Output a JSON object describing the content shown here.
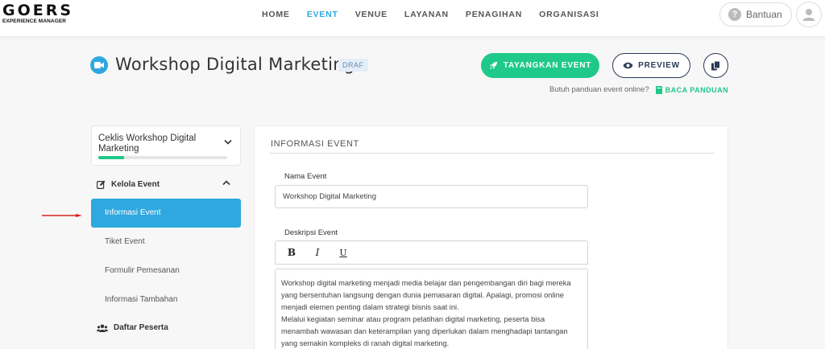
{
  "brand": {
    "logo_main": "GOERS",
    "logo_sub": "EXPERIENCE MANAGER"
  },
  "nav": {
    "items": [
      {
        "label": "HOME",
        "active": false
      },
      {
        "label": "EVENT",
        "active": true
      },
      {
        "label": "VENUE",
        "active": false
      },
      {
        "label": "LAYANAN",
        "active": false
      },
      {
        "label": "PENAGIHAN",
        "active": false
      },
      {
        "label": "ORGANISASI",
        "active": false
      }
    ],
    "help_label": "Bantuan"
  },
  "header": {
    "title": "Workshop Digital Marketing",
    "status_badge": "DRAF",
    "publish_label": "TAYANGKAN EVENT",
    "preview_label": "PREVIEW",
    "guide_question": "Butuh panduan event online?",
    "guide_link": "BACA PANDUAN"
  },
  "sidebar": {
    "checklist_title": "Ceklis Workshop Digital Marketing",
    "checklist_progress": 0.2,
    "manage_section": "Kelola Event",
    "menu": [
      {
        "label": "Informasi Event",
        "active": true
      },
      {
        "label": "Tiket Event",
        "active": false
      },
      {
        "label": "Formulir Pemesanan",
        "active": false
      },
      {
        "label": "Informasi Tambahan",
        "active": false
      }
    ],
    "participants_section": "Daftar Peserta"
  },
  "main": {
    "section_title": "INFORMASI EVENT",
    "name_label": "Nama Event",
    "name_value": "Workshop Digital Marketing",
    "desc_label": "Deskripsi Event",
    "toolbar": {
      "bold": "B",
      "italic": "I",
      "underline": "U"
    },
    "desc_paragraphs": [
      "Workshop digital marketing menjadi media belajar dan pengembangan diri bagi mereka yang bersentuhan langsung dengan dunia pemasaran digital. Apalagi, promosi online menjadi elemen penting dalam strategi bisnis saat ini.",
      "Melalui kegiatan seminar atau program pelatihan digital marketing, peserta bisa menambah wawasan dan keterampilan yang diperlukan dalam menghadapi tantangan yang semakin kompleks di ranah digital marketing."
    ]
  },
  "colors": {
    "accent_blue": "#2fa8df",
    "accent_green": "#1fc98a",
    "dark_navy": "#2b3a55",
    "arrow_red": "#d9231f"
  },
  "icons": [
    "video-camera-icon",
    "rocket-icon",
    "eye-icon",
    "copy-icon",
    "book-icon",
    "edit-icon",
    "users-icon",
    "question-icon",
    "user-icon",
    "chevron-down-icon",
    "chevron-up-icon"
  ]
}
